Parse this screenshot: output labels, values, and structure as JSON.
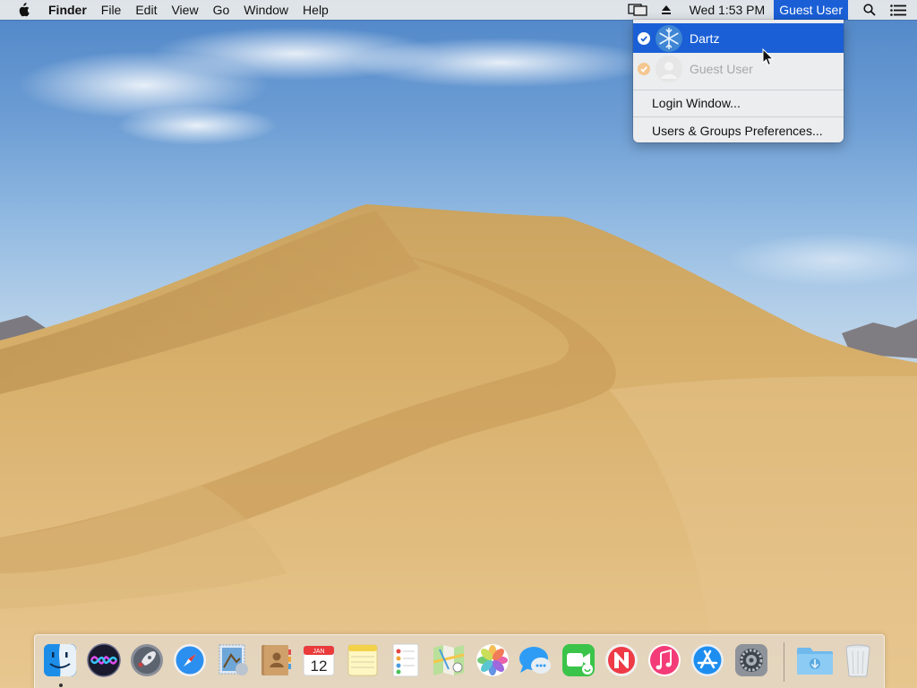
{
  "menubar": {
    "apple_icon": "apple-icon",
    "app_name": "Finder",
    "menus": [
      "File",
      "Edit",
      "View",
      "Go",
      "Window",
      "Help"
    ],
    "status_icons": [
      "airplay-display-icon",
      "eject-icon"
    ],
    "clock": "Wed 1:53 PM",
    "user": "Guest User",
    "right_icons": [
      "spotlight-search-icon",
      "notification-center-icon"
    ]
  },
  "user_menu": {
    "items": [
      {
        "label": "Dartz",
        "avatar": "snowflake-avatar-icon",
        "logged_in": true,
        "highlighted": true
      },
      {
        "label": "Guest User",
        "avatar": "guest-avatar-icon",
        "logged_in": true,
        "highlighted": false,
        "disabled": true
      }
    ],
    "login_window": "Login Window...",
    "preferences": "Users & Groups Preferences..."
  },
  "dock": {
    "apps": [
      "Finder",
      "Siri",
      "Launchpad",
      "Safari",
      "Mail",
      "Contacts",
      "Calendar",
      "Notes",
      "Reminders",
      "Maps",
      "Photos",
      "Messages",
      "FaceTime",
      "News",
      "iTunes",
      "App Store",
      "System Preferences"
    ],
    "calendar_month": "JAN",
    "calendar_day": "12",
    "stack_items": [
      "Downloads",
      "Trash"
    ],
    "running": [
      "Finder"
    ]
  },
  "colors": {
    "menu_highlight": "#1a5fd6",
    "sky": "#6e9ed4",
    "sand": "#d4a85e"
  }
}
